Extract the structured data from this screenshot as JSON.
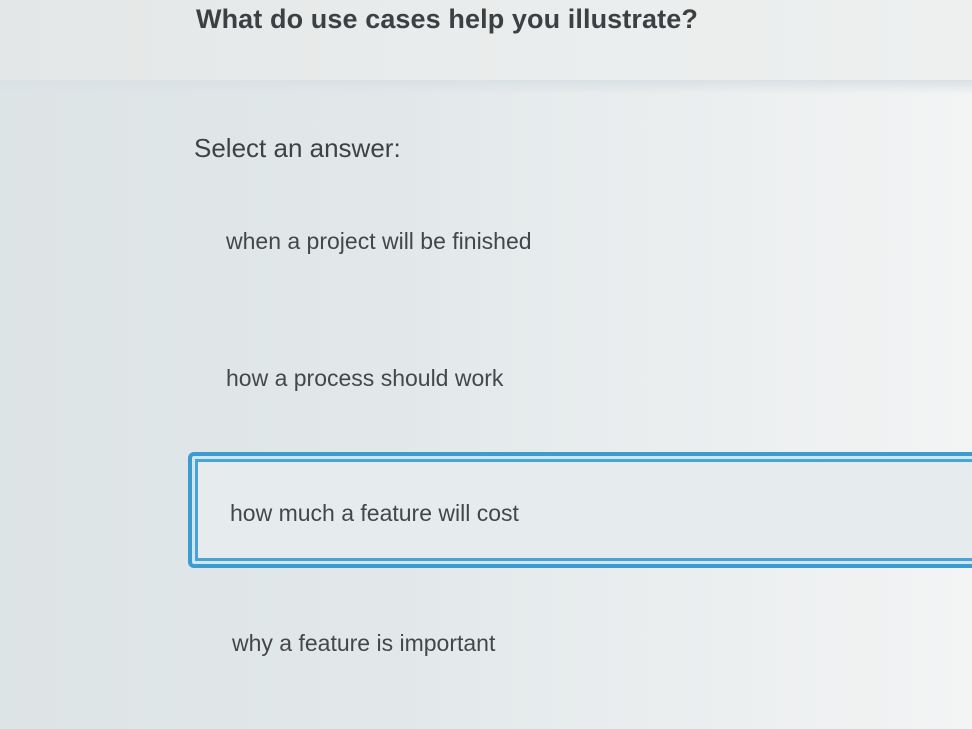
{
  "question": {
    "title": "What do use cases help you illustrate?"
  },
  "answers": {
    "prompt": "Select an answer:",
    "options": [
      {
        "label": "when a project will be finished",
        "selected": false
      },
      {
        "label": "how a process should work",
        "selected": false
      },
      {
        "label": "how much a feature will cost",
        "selected": true
      },
      {
        "label": "why a feature is important",
        "selected": false
      }
    ]
  },
  "colors": {
    "selected_border": "#3e9bd0",
    "text": "#3a3d40",
    "panel_background": "#e2e8ea"
  }
}
